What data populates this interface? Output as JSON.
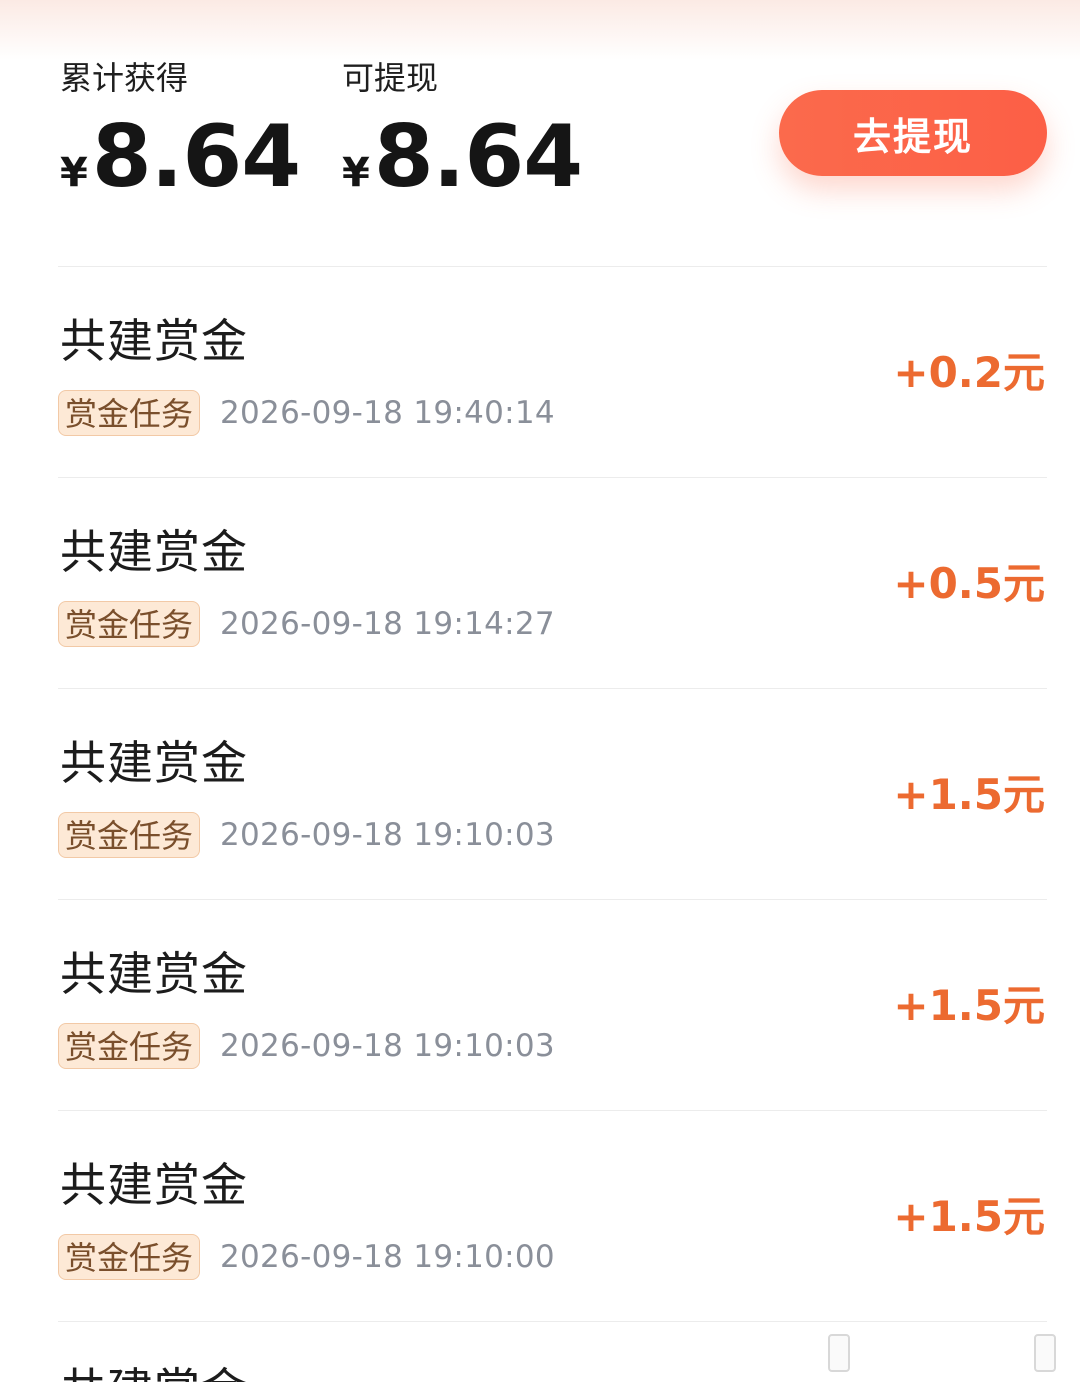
{
  "summary": {
    "total_label": "累计获得",
    "total_currency": "¥",
    "total_value": "8.64",
    "withdrawable_label": "可提现",
    "withdrawable_currency": "¥",
    "withdrawable_value": "8.64",
    "withdraw_button": "去提现"
  },
  "records": [
    {
      "title": "共建赏金",
      "tag": "赏金任务",
      "time": "2026-09-18 19:40:14",
      "amount": "+0.2元"
    },
    {
      "title": "共建赏金",
      "tag": "赏金任务",
      "time": "2026-09-18 19:14:27",
      "amount": "+0.5元"
    },
    {
      "title": "共建赏金",
      "tag": "赏金任务",
      "time": "2026-09-18 19:10:03",
      "amount": "+1.5元"
    },
    {
      "title": "共建赏金",
      "tag": "赏金任务",
      "time": "2026-09-18 19:10:03",
      "amount": "+1.5元"
    },
    {
      "title": "共建赏金",
      "tag": "赏金任务",
      "time": "2026-09-18 19:10:00",
      "amount": "+1.5元"
    }
  ],
  "partial_record": {
    "title": "共建赏金"
  },
  "colors": {
    "accent": "#fb6a4c",
    "amount": "#ec6a30",
    "tag_bg": "#fde9d6",
    "tag_text": "#7a4f2c",
    "muted": "#8a8f99"
  }
}
